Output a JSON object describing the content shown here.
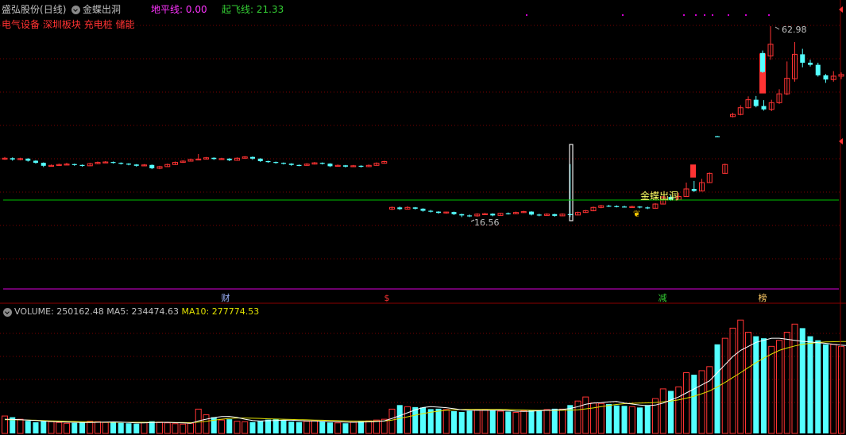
{
  "header": {
    "stock_name": "盛弘股份",
    "period": "(日线)",
    "indicator_name": "金蝶出洞",
    "ground_line_label": "地平线:",
    "ground_line_value": "0.00",
    "takeoff_line_label": "起飞线:",
    "takeoff_line_value": "21.33",
    "concept_tags": "电气设备 深圳板块 充电桩 储能"
  },
  "price_panel": {
    "high_label": "62.98",
    "low_label": "16.56",
    "signal_text": "金蝶出洞",
    "markers": [
      {
        "text": "财",
        "color": "#9fb4ff"
      },
      {
        "text": "$",
        "color": "#ff3333"
      },
      {
        "text": "减",
        "color": "#33cc33"
      },
      {
        "text": "榜",
        "color": "#ffcc66"
      }
    ]
  },
  "volume_panel": {
    "volume_label": "VOLUME:",
    "volume_value": "250162.48",
    "ma5_label": "MA5:",
    "ma5_value": "234474.63",
    "ma10_label": "MA10:",
    "ma10_value": "277774.53"
  },
  "colors": {
    "up": "#ff3333",
    "down": "#54ffff",
    "horizon_line": "#00c000",
    "separator": "#b000b0",
    "ma5": "#ffffff",
    "ma10": "#e0e000",
    "label_gray": "#c0c0c0"
  },
  "chart_data": [
    {
      "type": "candlestick",
      "series": [
        {
          "name": "K线",
          "values": [
            [
              31.5,
              31.6,
              31.9,
              31.2
            ],
            [
              31.6,
              31.3,
              31.8,
              31.0
            ],
            [
              31.3,
              31.5,
              31.7,
              31.1
            ],
            [
              31.5,
              31.0,
              31.6,
              30.8
            ],
            [
              31.0,
              30.5,
              31.1,
              30.3
            ],
            [
              30.5,
              29.8,
              30.6,
              29.5
            ],
            [
              29.8,
              29.9,
              30.1,
              29.6
            ],
            [
              29.9,
              30.1,
              30.3,
              29.8
            ],
            [
              30.1,
              30.2,
              30.5,
              30.0
            ],
            [
              30.2,
              30.0,
              30.3,
              29.8
            ],
            [
              30.0,
              29.8,
              30.1,
              29.6
            ],
            [
              29.8,
              30.3,
              30.5,
              29.7
            ],
            [
              30.3,
              30.6,
              30.8,
              30.2
            ],
            [
              30.6,
              30.7,
              30.9,
              30.5
            ],
            [
              30.7,
              30.5,
              30.8,
              30.3
            ],
            [
              30.5,
              30.3,
              30.6,
              30.1
            ],
            [
              30.3,
              30.1,
              30.4,
              29.9
            ],
            [
              30.1,
              29.8,
              30.2,
              29.6
            ],
            [
              29.8,
              30.0,
              30.2,
              29.7
            ],
            [
              30.0,
              29.2,
              30.1,
              29.0
            ],
            [
              29.2,
              29.6,
              29.8,
              29.0
            ],
            [
              29.6,
              30.1,
              30.3,
              29.5
            ],
            [
              30.1,
              30.6,
              30.8,
              30.0
            ],
            [
              30.6,
              30.9,
              31.1,
              30.5
            ],
            [
              30.9,
              31.3,
              31.5,
              30.8
            ],
            [
              31.3,
              31.4,
              32.6,
              31.2
            ],
            [
              31.4,
              31.7,
              31.9,
              31.3
            ],
            [
              31.7,
              31.4,
              31.8,
              31.2
            ],
            [
              31.4,
              31.5,
              31.7,
              31.3
            ],
            [
              31.5,
              31.1,
              31.6,
              30.9
            ],
            [
              31.1,
              31.6,
              31.8,
              31.0
            ],
            [
              31.6,
              31.9,
              32.1,
              31.5
            ],
            [
              31.9,
              31.5,
              32.0,
              31.2
            ],
            [
              31.5,
              30.9,
              31.6,
              30.7
            ],
            [
              30.9,
              30.7,
              31.0,
              30.5
            ],
            [
              30.7,
              30.5,
              30.8,
              30.3
            ],
            [
              30.5,
              30.3,
              30.6,
              30.1
            ],
            [
              30.3,
              30.0,
              30.4,
              29.8
            ],
            [
              30.0,
              29.9,
              30.1,
              29.7
            ],
            [
              29.9,
              30.2,
              30.4,
              29.8
            ],
            [
              30.2,
              30.5,
              30.7,
              30.1
            ],
            [
              30.5,
              30.3,
              30.6,
              30.1
            ],
            [
              30.3,
              29.7,
              30.4,
              29.5
            ],
            [
              29.7,
              29.9,
              30.1,
              29.6
            ],
            [
              29.9,
              29.6,
              30.0,
              29.4
            ],
            [
              29.6,
              29.8,
              30.0,
              29.5
            ],
            [
              29.8,
              29.6,
              29.9,
              29.4
            ],
            [
              29.6,
              29.9,
              30.1,
              29.5
            ],
            [
              29.9,
              30.4,
              30.6,
              29.8
            ],
            [
              30.4,
              30.8,
              31.0,
              30.3
            ],
            [
              19.5,
              19.9,
              20.1,
              19.3
            ],
            [
              19.9,
              19.5,
              20.1,
              19.3
            ],
            [
              19.5,
              19.9,
              20.2,
              19.4
            ],
            [
              19.9,
              19.6,
              20.0,
              19.4
            ],
            [
              19.6,
              19.1,
              19.7,
              18.9
            ],
            [
              19.1,
              18.9,
              19.3,
              18.7
            ],
            [
              18.9,
              18.6,
              19.0,
              18.4
            ],
            [
              18.6,
              18.8,
              18.9,
              18.4
            ],
            [
              18.8,
              18.3,
              18.9,
              18.1
            ],
            [
              18.3,
              18.0,
              18.4,
              17.6
            ],
            [
              18.0,
              17.9,
              18.2,
              17.6
            ],
            [
              17.9,
              18.3,
              18.5,
              17.7
            ],
            [
              18.3,
              18.4,
              18.6,
              18.1
            ],
            [
              18.4,
              18.0,
              18.5,
              17.8
            ],
            [
              18.0,
              18.5,
              18.6,
              17.9
            ],
            [
              18.5,
              18.4,
              18.7,
              18.2
            ],
            [
              18.4,
              18.7,
              18.9,
              18.3
            ],
            [
              18.7,
              18.9,
              19.1,
              18.6
            ],
            [
              18.9,
              18.2,
              19.0,
              18.0
            ],
            [
              18.2,
              18.0,
              18.4,
              17.8
            ],
            [
              18.0,
              18.3,
              18.5,
              17.9
            ],
            [
              18.3,
              17.9,
              18.4,
              17.7
            ],
            [
              17.9,
              18.3,
              18.5,
              17.8
            ],
            [
              18.3,
              18.1,
              30.2,
              17.6
            ],
            [
              18.1,
              18.7,
              18.9,
              18.0
            ],
            [
              18.7,
              19.1,
              19.3,
              18.6
            ],
            [
              19.1,
              19.9,
              20.1,
              19.0
            ],
            [
              19.9,
              20.3,
              20.5,
              19.7
            ],
            [
              20.3,
              20.2,
              20.5,
              20.0
            ],
            [
              20.2,
              20.1,
              20.4,
              19.9
            ],
            [
              20.1,
              20.0,
              20.3,
              19.9
            ],
            [
              20.0,
              20.1,
              20.3,
              19.9
            ],
            [
              20.1,
              19.9,
              20.2,
              19.7
            ],
            [
              19.9,
              19.7,
              20.1,
              19.5
            ],
            [
              19.7,
              20.7,
              20.9,
              19.6
            ],
            [
              20.7,
              22.4,
              22.6,
              20.6
            ],
            [
              22.4,
              21.7,
              22.9,
              21.5
            ],
            [
              21.7,
              22.5,
              23.4,
              21.6
            ],
            [
              22.5,
              24.3,
              25.8,
              22.4
            ],
            [
              24.3,
              23.8,
              26.2,
              23.6
            ],
            [
              23.8,
              25.8,
              26.7,
              23.7
            ],
            [
              25.8,
              28.0,
              28.2,
              25.7
            ],
            [
              36.8,
              36.7,
              36.9,
              36.6
            ],
            [
              28.0,
              30.1,
              30.3,
              27.9
            ],
            [
              41.5,
              42.0,
              42.4,
              41.3
            ],
            [
              42.0,
              43.6,
              44.2,
              41.8
            ],
            [
              43.6,
              45.5,
              46.3,
              43.4
            ],
            [
              45.5,
              44.0,
              46.4,
              43.7
            ],
            [
              44.0,
              43.2,
              45.4,
              42.9
            ],
            [
              43.2,
              44.8,
              45.5,
              42.8
            ],
            [
              44.8,
              46.9,
              48.0,
              44.5
            ],
            [
              46.9,
              50.6,
              54.6,
              46.6
            ],
            [
              50.5,
              56.3,
              59.2,
              49.8
            ],
            [
              56.3,
              54.3,
              57.6,
              53.2
            ],
            [
              54.3,
              53.8,
              55.0,
              53.4
            ],
            [
              53.8,
              51.3,
              54.3,
              51.0
            ],
            [
              51.3,
              50.3,
              51.6,
              49.5
            ],
            [
              50.3,
              51.1,
              52.3,
              49.8
            ],
            [
              51.1,
              51.5,
              52.0,
              50.4
            ],
            [
              51.5,
              51.4,
              52.9,
              51.1
            ],
            [
              51.4,
              51.0,
              51.8,
              50.5
            ],
            [
              51.0,
              52.3,
              53.0,
              50.6
            ]
          ]
        }
      ],
      "extra_bars": [
        [
          56.6,
          52.1,
          57.2,
          51.9
        ],
        [
          55.9,
          58.7,
          62.98,
          55.0
        ]
      ]
    },
    {
      "type": "bar",
      "series": [
        {
          "name": "VOLUME",
          "values": [
            86,
            80,
            70,
            62,
            55,
            60,
            58,
            54,
            50,
            52,
            55,
            60,
            58,
            54,
            56,
            52,
            50,
            48,
            54,
            60,
            56,
            52,
            48,
            46,
            50,
            120,
            92,
            80,
            66,
            70,
            60,
            58,
            56,
            62,
            68,
            70,
            64,
            58,
            56,
            60,
            62,
            58,
            54,
            52,
            50,
            56,
            60,
            62,
            66,
            70,
            120,
            140,
            132,
            130,
            128,
            120,
            122,
            118,
            110,
            106,
            112,
            116,
            118,
            114,
            110,
            108,
            104,
            112,
            116,
            114,
            118,
            122,
            120,
            140,
            160,
            180,
            150,
            148,
            145,
            138,
            136,
            132,
            128,
            140,
            172,
            220,
            210,
            230,
            300,
            290,
            310,
            330,
            440,
            470,
            520,
            560,
            500,
            480,
            470,
            430,
            460,
            500,
            540,
            520,
            480,
            460,
            440,
            440,
            430,
            420
          ]
        },
        {
          "name": "MA5",
          "values": [
            70,
            69,
            68,
            66,
            64,
            61,
            59,
            57,
            56,
            55,
            54,
            54,
            55,
            56,
            57,
            56,
            54,
            52,
            52,
            54,
            54,
            55,
            53,
            52,
            50,
            62,
            70,
            78,
            83,
            84,
            79,
            70,
            64,
            61,
            63,
            64,
            66,
            65,
            63,
            62,
            61,
            60,
            59,
            58,
            56,
            55,
            56,
            57,
            59,
            62,
            74,
            88,
            102,
            116,
            128,
            132,
            130,
            127,
            122,
            117,
            115,
            114,
            114,
            114,
            114,
            113,
            110,
            109,
            110,
            112,
            114,
            116,
            118,
            123,
            132,
            144,
            150,
            152,
            156,
            158,
            150,
            145,
            140,
            137,
            140,
            150,
            165,
            180,
            200,
            220,
            240,
            260,
            300,
            340,
            380,
            410,
            430,
            450,
            460,
            470,
            470,
            465,
            460,
            455,
            452,
            448,
            445,
            440,
            436,
            433
          ]
        },
        {
          "name": "MA10",
          "values": [
            68,
            68,
            67,
            66,
            65,
            63,
            62,
            61,
            60,
            59,
            58,
            57,
            56,
            55,
            55,
            55,
            55,
            55,
            55,
            55,
            55,
            55,
            54,
            54,
            53,
            56,
            60,
            65,
            70,
            74,
            76,
            76,
            75,
            74,
            72,
            71,
            70,
            69,
            68,
            67,
            66,
            65,
            64,
            63,
            62,
            61,
            61,
            61,
            61,
            61,
            66,
            74,
            82,
            90,
            98,
            105,
            110,
            114,
            117,
            118,
            119,
            119,
            119,
            119,
            119,
            118,
            117,
            116,
            115,
            114,
            114,
            114,
            114,
            115,
            117,
            121,
            126,
            132,
            138,
            143,
            147,
            149,
            150,
            151,
            153,
            156,
            160,
            166,
            174,
            184,
            196,
            210,
            230,
            252,
            276,
            300,
            325,
            350,
            372,
            392,
            410,
            422,
            432,
            440,
            445,
            449,
            452,
            453,
            454,
            454
          ]
        }
      ]
    }
  ]
}
